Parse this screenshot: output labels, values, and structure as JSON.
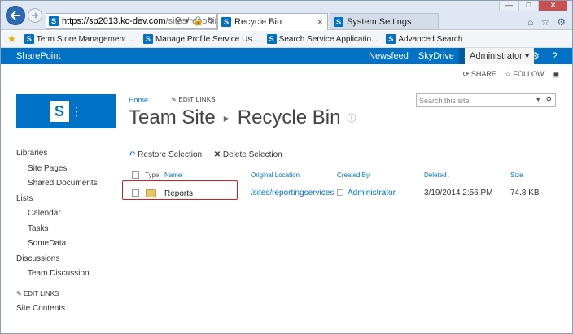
{
  "browser": {
    "address_host": "https://sp2013.kc-dev.com",
    "address_path": "/sites/reportir",
    "tabs": [
      {
        "label": "Recycle Bin"
      },
      {
        "label": "System Settings"
      }
    ],
    "favorites": [
      "Term Store Management ...",
      "Manage Profile Service Us...",
      "Search Service Applicatio...",
      "Advanced Search"
    ]
  },
  "suite": {
    "brand": "SharePoint",
    "links": [
      "Newsfeed",
      "SkyDrive",
      "Sites"
    ],
    "user": "Administrator ▾"
  },
  "actions": {
    "share": "SHARE",
    "follow": "FOLLOW"
  },
  "topnav": {
    "home": "Home",
    "edit_links": "EDIT LINKS"
  },
  "title": {
    "site": "Team Site",
    "page": "Recycle Bin"
  },
  "search": {
    "placeholder": "Search this site"
  },
  "quicklaunch": [
    {
      "label": "Libraries",
      "level": 0
    },
    {
      "label": "Site Pages",
      "level": 1
    },
    {
      "label": "Shared Documents",
      "level": 1
    },
    {
      "label": "Lists",
      "level": 0
    },
    {
      "label": "Calendar",
      "level": 1
    },
    {
      "label": "Tasks",
      "level": 1
    },
    {
      "label": "SomeData",
      "level": 1
    },
    {
      "label": "Discussions",
      "level": 0
    },
    {
      "label": "Team Discussion",
      "level": 1
    }
  ],
  "ql_footer": {
    "edit_links": "EDIT LINKS",
    "site_contents": "Site Contents"
  },
  "toolbar": {
    "restore": "Restore Selection",
    "delete": "Delete Selection"
  },
  "grid": {
    "headers": {
      "type": "Type",
      "name": "Name",
      "original_location": "Original Location",
      "created_by": "Created By",
      "deleted": "Deleted↓",
      "size": "Size"
    },
    "rows": [
      {
        "name": "Reports",
        "original_location": "/sites/reportingservices",
        "created_by": "Administrator",
        "deleted": "3/19/2014 2:56 PM",
        "size": "74.8 KB"
      }
    ]
  },
  "colors": {
    "brand_blue": "#0072c6",
    "highlight_red": "#d12020"
  }
}
